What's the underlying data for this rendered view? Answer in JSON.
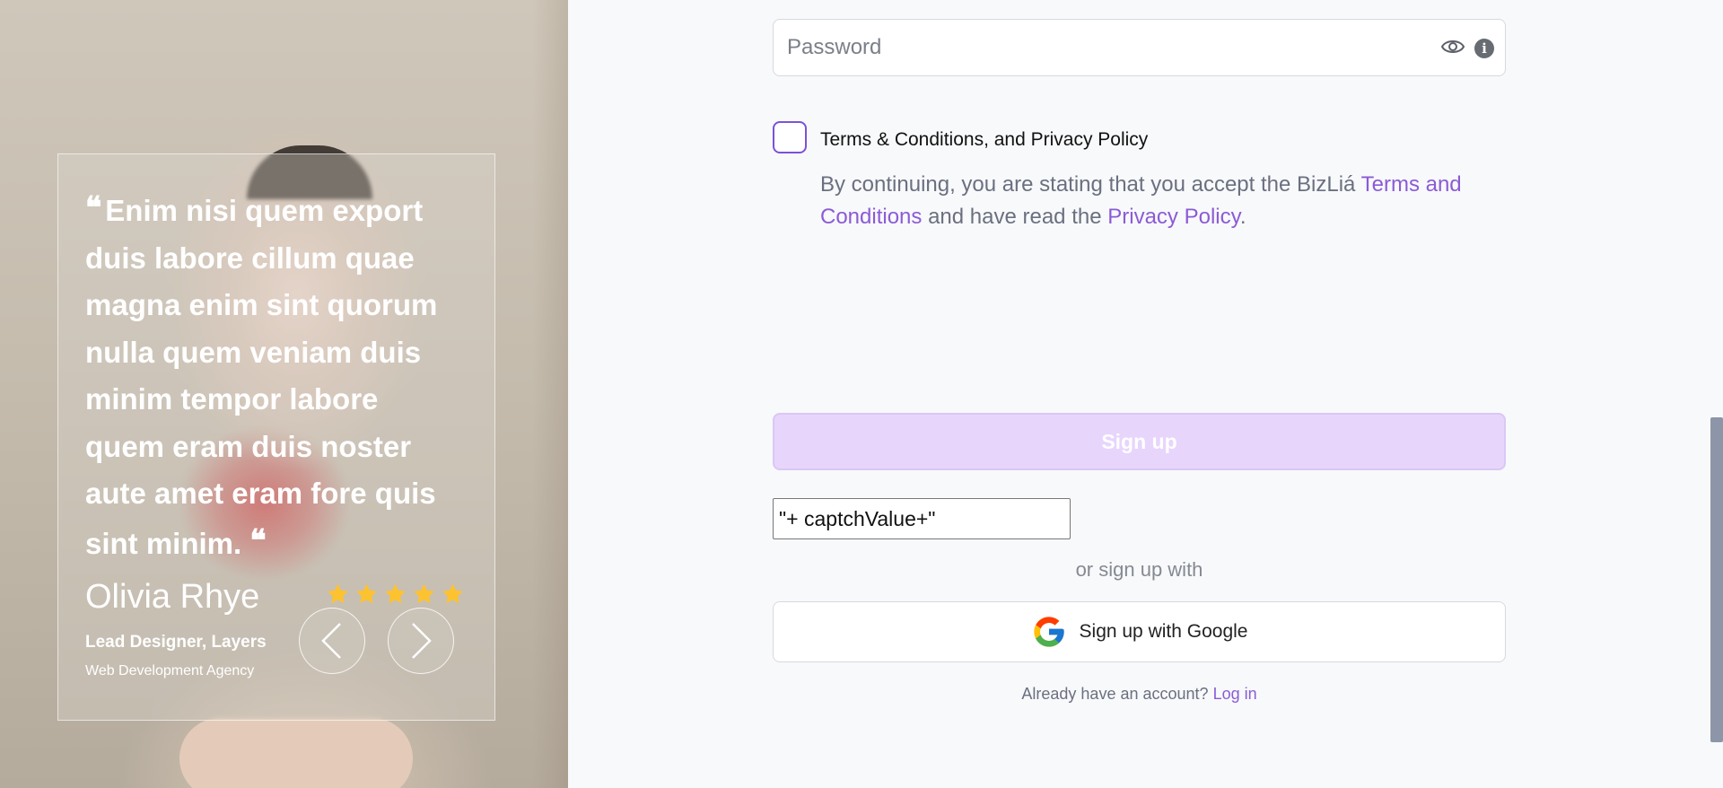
{
  "testimonial": {
    "quote": "Enim nisi quem export duis labore cillum quae magna enim sint quorum nulla quem veniam duis minim tempor labore quem eram duis noster aute amet eram fore quis sint minim.",
    "open_mark": "❝",
    "close_mark": "❝",
    "author": "Olivia Rhye",
    "role": "Lead Designer, Layers",
    "company": "Web Development Agency",
    "rating": 5,
    "star_color": "#fdc230",
    "prev_label": "previous-testimonial",
    "next_label": "next-testimonial"
  },
  "form": {
    "password": {
      "placeholder": "Password",
      "value": ""
    },
    "terms_checkbox_label": "Terms & Conditions, and Privacy Policy",
    "consent": {
      "prefix": "By continuing, you are stating that you accept the BizLiá ",
      "terms_link": "Terms and Conditions",
      "middle": " and have read the ",
      "privacy_link": "Privacy Policy",
      "suffix": "."
    },
    "signup_label": "Sign up",
    "captcha_value": "\"+ captchValue+\"",
    "or_text": "or sign up with",
    "google_label": "Sign up with Google",
    "login_prompt": "Already have an account?",
    "login_link": "Log in"
  },
  "colors": {
    "accent": "#8b5bd6",
    "signup_bg": "#e7d5fc",
    "page_bg": "#f8f9fb"
  },
  "icons": {
    "eye": "eye-icon",
    "info": "info-icon",
    "google": "google-logo-icon",
    "star": "star-icon",
    "prev": "chevron-left-icon",
    "next": "chevron-right-icon"
  }
}
